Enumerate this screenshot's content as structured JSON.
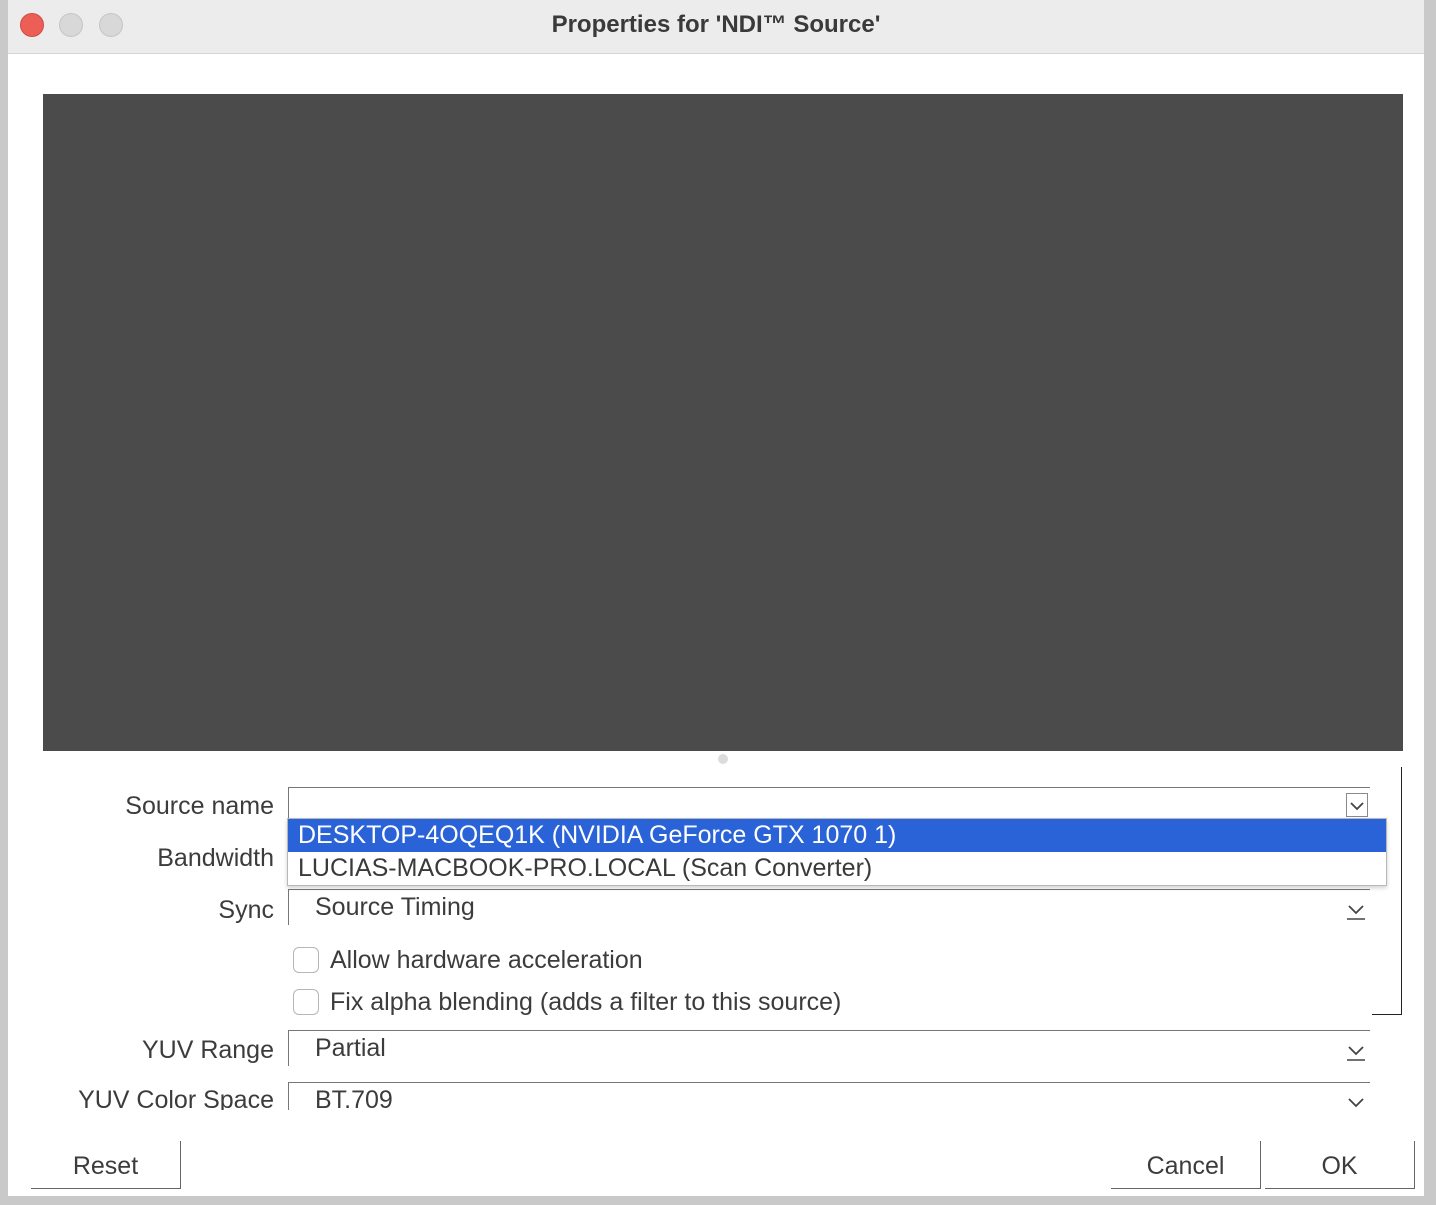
{
  "window": {
    "title": "Properties for 'NDI™ Source'"
  },
  "form": {
    "source_name": {
      "label": "Source name",
      "value": ""
    },
    "bandwidth": {
      "label": "Bandwidth"
    },
    "sync": {
      "label": "Sync",
      "value": "Source Timing"
    },
    "allow_hw_accel": {
      "label": "Allow hardware acceleration",
      "checked": false
    },
    "fix_alpha": {
      "label": "Fix alpha blending (adds a filter to this source)",
      "checked": false
    },
    "yuv_range": {
      "label": "YUV Range",
      "value": "Partial"
    },
    "yuv_color_space": {
      "label": "YUV Color Space",
      "value": "BT.709"
    }
  },
  "dropdown": {
    "options": [
      {
        "label": "DESKTOP-4OQEQ1K (NVIDIA GeForce GTX 1070 1)",
        "selected": true
      },
      {
        "label": "LUCIAS-MACBOOK-PRO.LOCAL (Scan Converter)",
        "selected": false
      }
    ]
  },
  "buttons": {
    "reset": "Reset",
    "cancel": "Cancel",
    "ok": "OK"
  },
  "colors": {
    "selection": "#2a63d8",
    "preview": "#4b4b4b",
    "close": "#ec5f57"
  },
  "icons": {
    "combo_arrow": "chevron-down-icon"
  }
}
